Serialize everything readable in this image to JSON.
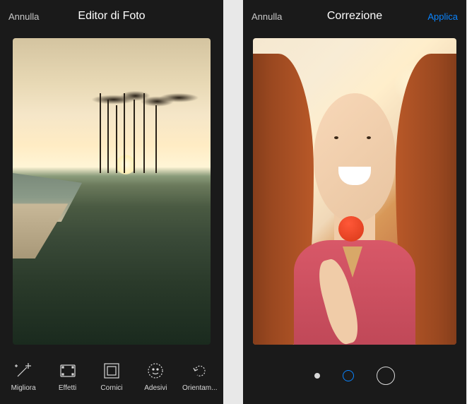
{
  "screen1": {
    "header": {
      "cancel": "Annulla",
      "title": "Editor di Foto",
      "apply": ""
    },
    "tools": [
      {
        "icon": "wand-icon",
        "label": "Migliora"
      },
      {
        "icon": "effects-icon",
        "label": "Effetti"
      },
      {
        "icon": "frames-icon",
        "label": "Cornici"
      },
      {
        "icon": "stickers-icon",
        "label": "Adesivi"
      },
      {
        "icon": "orientation-icon",
        "label": "Orientam..."
      }
    ]
  },
  "screen2": {
    "header": {
      "cancel": "Annulla",
      "title": "Correzione",
      "apply": "Applica"
    },
    "intensity": {
      "levels": [
        "small",
        "medium",
        "large"
      ],
      "selected_index": 1,
      "accent_color": "#0a84ff"
    }
  }
}
